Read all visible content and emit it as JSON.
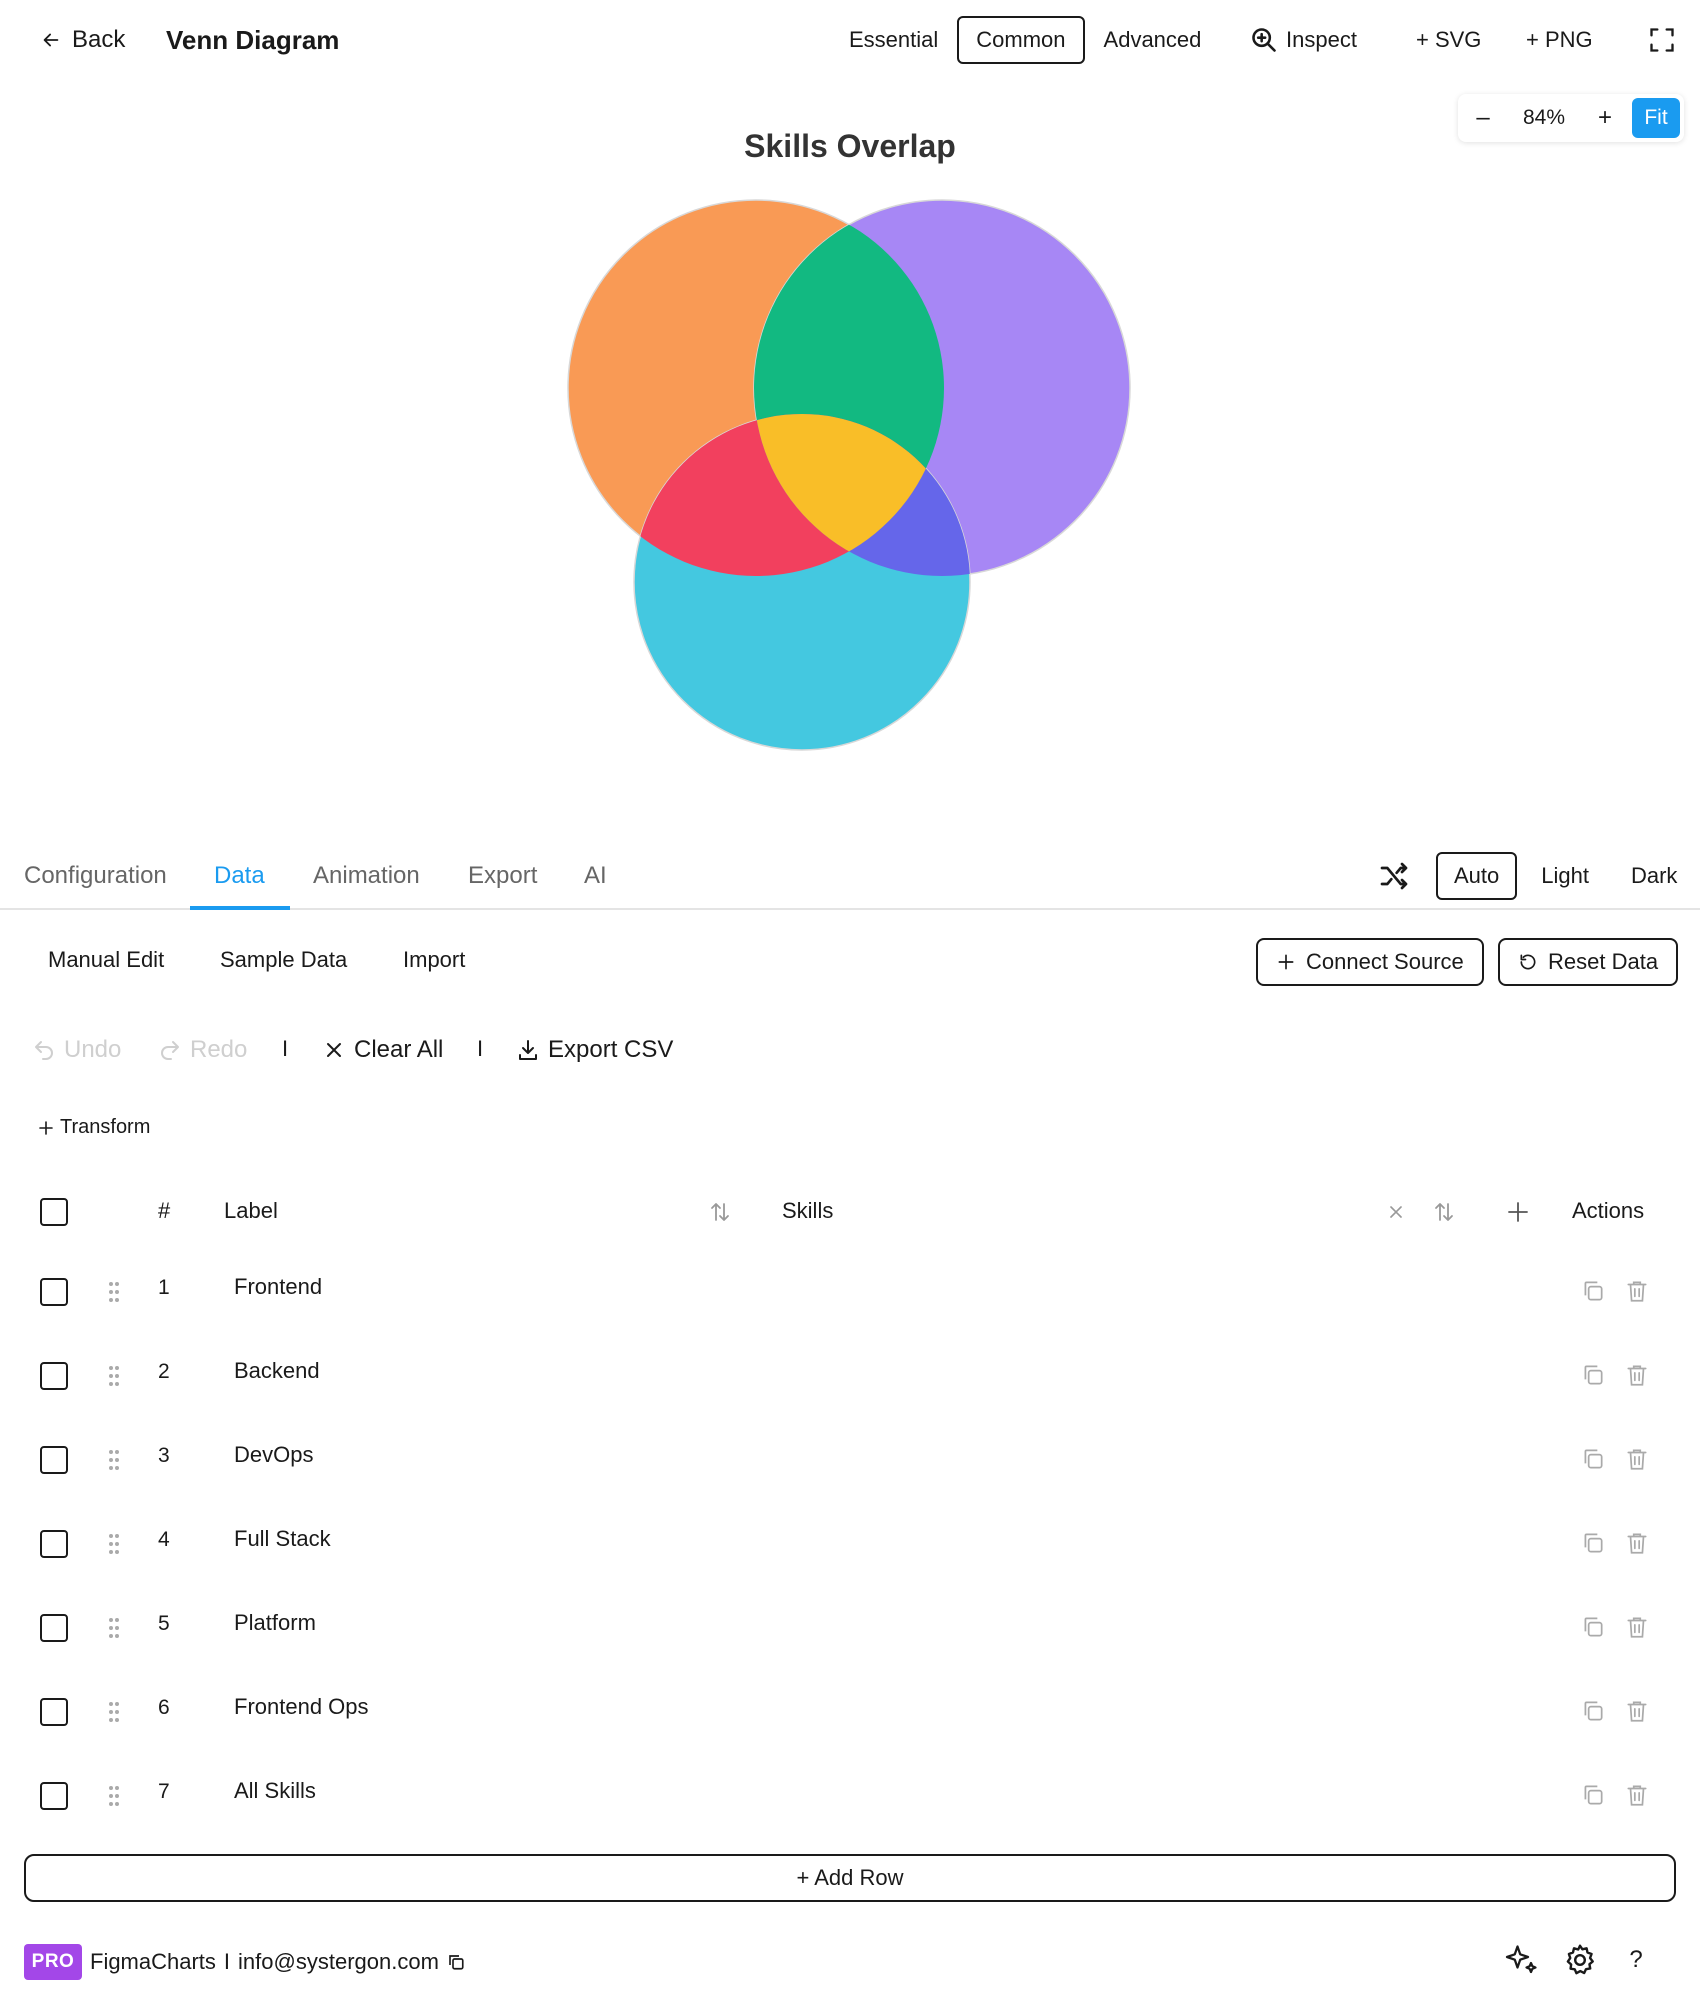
{
  "header": {
    "back_label": "Back",
    "title": "Venn Diagram",
    "modes": [
      {
        "label": "Essential",
        "active": false
      },
      {
        "label": "Common",
        "active": true
      },
      {
        "label": "Advanced",
        "active": false
      }
    ],
    "inspect_label": "Inspect",
    "svg_label": "+ SVG",
    "png_label": "+ PNG"
  },
  "zoom": {
    "minus": "–",
    "value": "84%",
    "plus": "+",
    "fit": "Fit"
  },
  "chart_data": {
    "type": "venn",
    "title": "Skills Overlap",
    "sets": [
      {
        "name": "Frontend",
        "color": "#f99a55"
      },
      {
        "name": "Backend",
        "color": "#a787f5"
      },
      {
        "name": "DevOps",
        "color": "#44c8e0"
      }
    ],
    "intersections": [
      {
        "sets": [
          "Frontend",
          "Backend"
        ],
        "color": "#12b981"
      },
      {
        "sets": [
          "Frontend",
          "DevOps"
        ],
        "color": "#f2405e"
      },
      {
        "sets": [
          "Backend",
          "DevOps"
        ],
        "color": "#6566ea"
      },
      {
        "sets": [
          "Frontend",
          "Backend",
          "DevOps"
        ],
        "color": "#f9be28"
      }
    ]
  },
  "tabs": [
    "Configuration",
    "Data",
    "Animation",
    "Export",
    "AI"
  ],
  "active_tab": "Data",
  "theme": {
    "options": [
      "Auto",
      "Light",
      "Dark"
    ],
    "active": "Auto"
  },
  "subtabs": [
    "Manual Edit",
    "Sample Data",
    "Import"
  ],
  "connect_source": "Connect Source",
  "reset_data": "Reset Data",
  "toolbar": {
    "undo": "Undo",
    "redo": "Redo",
    "sep": "I",
    "clear_all": "Clear All",
    "export_csv": "Export CSV"
  },
  "transform": "Transform",
  "table": {
    "headers": {
      "num": "#",
      "label": "Label",
      "skills": "Skills",
      "actions": "Actions"
    },
    "rows": [
      {
        "num": "1",
        "label": "Frontend"
      },
      {
        "num": "2",
        "label": "Backend"
      },
      {
        "num": "3",
        "label": "DevOps"
      },
      {
        "num": "4",
        "label": "Full Stack"
      },
      {
        "num": "5",
        "label": "Platform"
      },
      {
        "num": "6",
        "label": "Frontend Ops"
      },
      {
        "num": "7",
        "label": "All Skills"
      }
    ]
  },
  "add_row": "+ Add Row",
  "footer": {
    "badge": "PRO",
    "brand": "FigmaCharts",
    "sep": "I",
    "email": "info@systergon.com",
    "help": "?"
  },
  "colors": {
    "accent": "#1a9bf0",
    "pro": "#a347e8"
  }
}
